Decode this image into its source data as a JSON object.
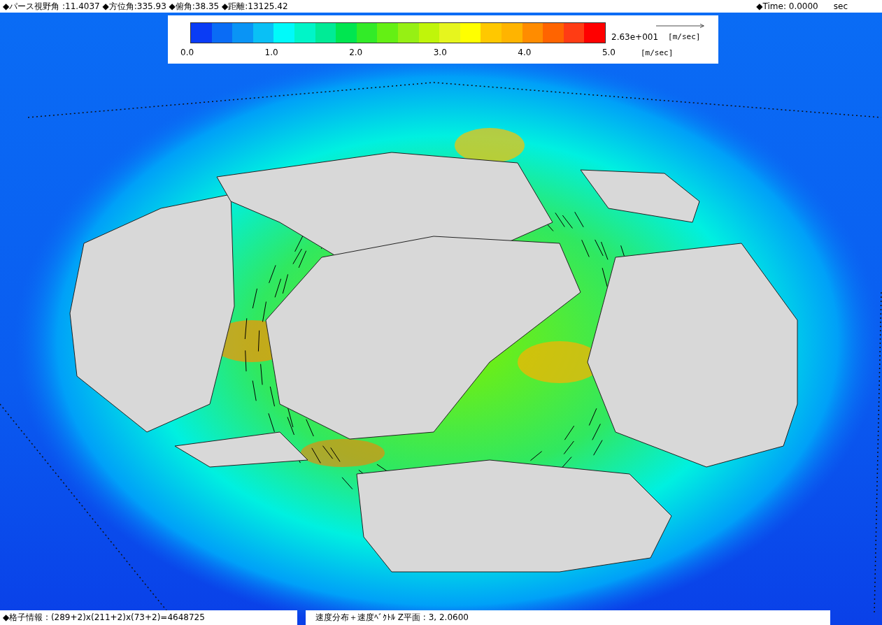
{
  "header": {
    "view_info": "◆パース視野角 :11.4037 ◆方位角:335.93 ◆俯角:38.35  ◆距離:13125.42",
    "time_label": "◆Time: 0.0000",
    "time_unit": "sec"
  },
  "legend": {
    "swatches": [
      {
        "color": "#0a3cf5"
      },
      {
        "color": "#0a6cf5"
      },
      {
        "color": "#0a94f5"
      },
      {
        "color": "#0ac0f5"
      },
      {
        "color": "#00fafa"
      },
      {
        "color": "#00f5c8"
      },
      {
        "color": "#00eb96"
      },
      {
        "color": "#00e650"
      },
      {
        "color": "#32eb28"
      },
      {
        "color": "#64f014"
      },
      {
        "color": "#96f014"
      },
      {
        "color": "#c0f50a"
      },
      {
        "color": "#e6f51e"
      },
      {
        "color": "#ffff00"
      },
      {
        "color": "#ffc800"
      },
      {
        "color": "#ffb400"
      },
      {
        "color": "#ff8c00"
      },
      {
        "color": "#ff6400"
      },
      {
        "color": "#ff3c14"
      },
      {
        "color": "#ff0000"
      }
    ],
    "ticks": [
      "0.0",
      "1.0",
      "2.0",
      "3.0",
      "4.0",
      "5.0"
    ],
    "unit": "[m/sec]",
    "vector_scale": "2.63e+001",
    "vector_unit": "[m/sec]"
  },
  "status": {
    "grid_info": "◆格子情報 : (289+2)x(211+2)x(73+2)=4648725",
    "display_mode": "速度分布＋速度ﾍﾞｸﾄﾙ Z平面 : 3,  2.0600"
  }
}
